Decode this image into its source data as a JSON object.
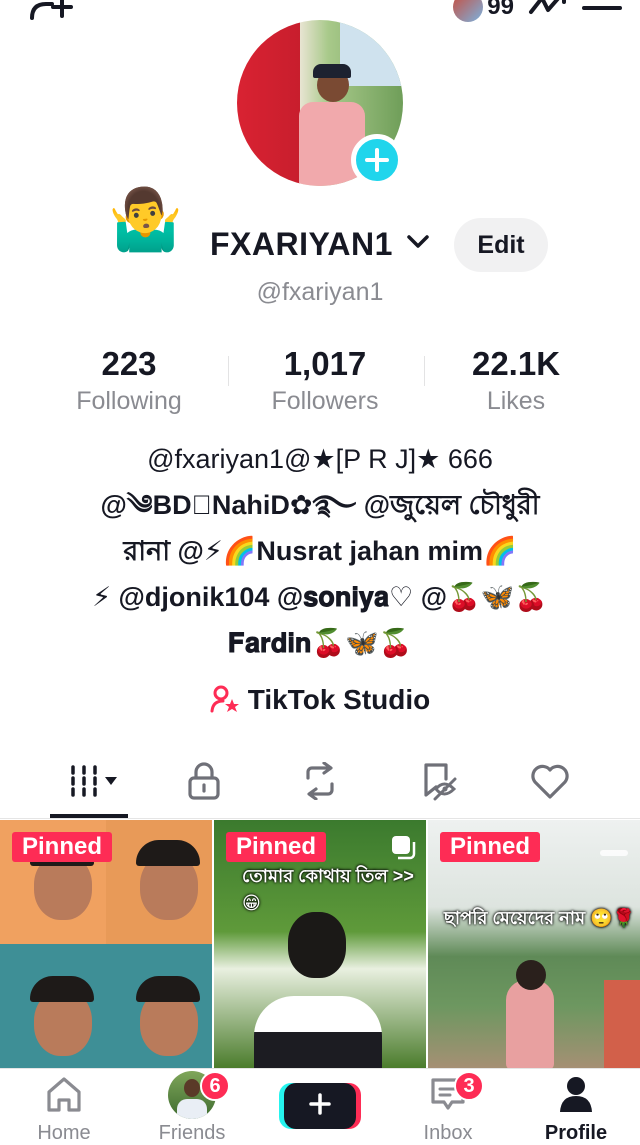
{
  "header": {
    "coin_count": "99"
  },
  "profile": {
    "emoji": "🤷‍♂️",
    "display_name": "FXARIYAN1",
    "edit_label": "Edit",
    "handle": "@fxariyan1"
  },
  "stats": [
    {
      "value": "223",
      "label": "Following"
    },
    {
      "value": "1,017",
      "label": "Followers"
    },
    {
      "value": "22.1K",
      "label": "Likes"
    }
  ],
  "bio": {
    "lines": [
      "@fxariyan1@★[P    R     J]★ 666",
      "@༄BD⃝NahiD✿࿐ @জুয়েল চৌধুরী",
      "রানা @⚡🌈Nusrat jahan mim🌈",
      "⚡ @djonik104 @𝐬𝐨𝐧𝐢𝐲𝐚♡ @🍒🦋🍒",
      "𝐅𝐚𝐫𝐝𝐢𝐧🍒🦋🍒"
    ]
  },
  "studio": {
    "label": "TikTok Studio"
  },
  "tabs": [
    "videos-grid",
    "private",
    "reposts",
    "favorites",
    "liked"
  ],
  "videos": [
    {
      "pinned_label": "Pinned",
      "caption": ""
    },
    {
      "pinned_label": "Pinned",
      "caption": "তোমার কোথায় তিল >>😁"
    },
    {
      "pinned_label": "Pinned",
      "caption": "ছাপরি মেয়েদের নাম 🙄🌹"
    }
  ],
  "bottom_nav": {
    "home": "Home",
    "friends": "Friends",
    "friends_badge": "6",
    "inbox": "Inbox",
    "inbox_badge": "3",
    "profile": "Profile"
  },
  "colors": {
    "accent": "#fe2c55",
    "cyan": "#25f4ee",
    "plus_badge": "#20d5ec",
    "text": "#161823",
    "muted": "#8a8b91"
  }
}
